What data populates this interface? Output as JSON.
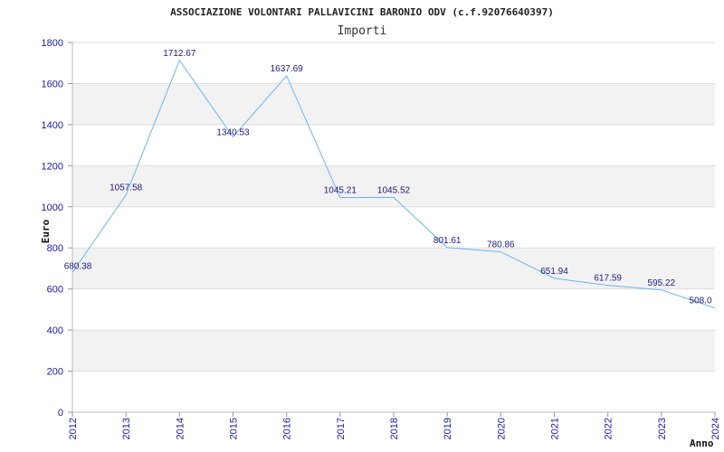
{
  "chart_data": {
    "type": "line",
    "title": "ASSOCIAZIONE VOLONTARI PALLAVICINI BARONIO ODV (c.f.92076640397)",
    "subtitle": "Importi",
    "xlabel": "Anno",
    "ylabel": "Euro",
    "ylim": [
      0,
      1800
    ],
    "yticks": [
      "0",
      "200",
      "400",
      "600",
      "800",
      "1000",
      "1200",
      "1400",
      "1600",
      "1800"
    ],
    "categories": [
      "2012",
      "2013",
      "2014",
      "2015",
      "2016",
      "2017",
      "2018",
      "2019",
      "2020",
      "2021",
      "2022",
      "2023",
      "2024"
    ],
    "values": [
      680.38,
      1057.58,
      1712.67,
      1340.53,
      1637.69,
      1045.21,
      1045.52,
      801.61,
      780.86,
      651.94,
      617.59,
      595.22,
      508.0
    ],
    "value_labels": [
      "680.38",
      "1057.58",
      "1712.67",
      "1340.53",
      "1637.69",
      "1045.21",
      "1045.52",
      "801.61",
      "780.86",
      "651.94",
      "617.59",
      "595.22",
      "508.0"
    ],
    "grid": true,
    "colors": {
      "line": "#6cb4ee",
      "band": "#f2f2f2",
      "tick_text": "#1a1aa6",
      "label_text": "#1a1a80"
    }
  }
}
